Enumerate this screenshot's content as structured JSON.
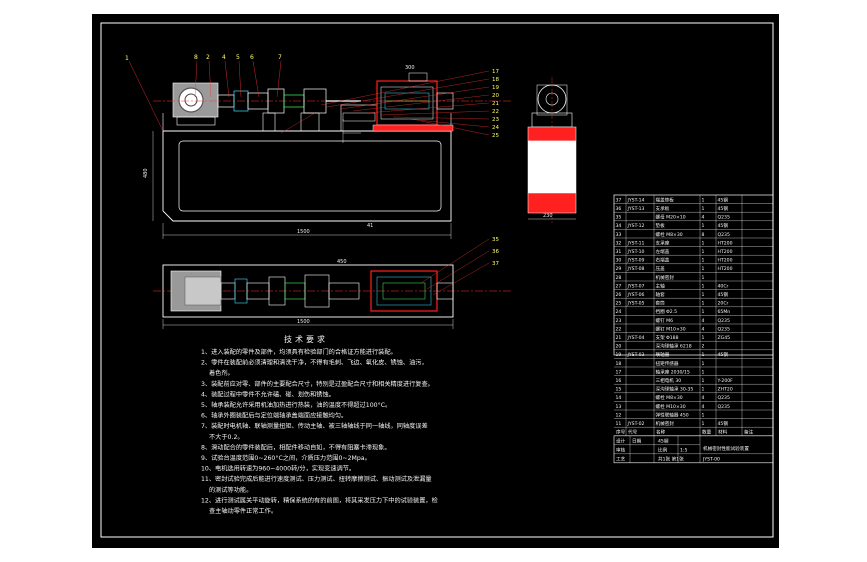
{
  "balloons": {
    "left": [
      "8",
      "2",
      "4",
      "5",
      "6",
      "7"
    ],
    "far_left": "1",
    "right": [
      "17",
      "18",
      "19",
      "20",
      "21",
      "22",
      "23",
      "24",
      "25"
    ],
    "plan": [
      "35",
      "36",
      "37"
    ]
  },
  "dims": {
    "front_len": "1500",
    "front_h": "480",
    "front_off": "41",
    "front_seg": "300",
    "plan_len": "1500",
    "plan_seg": "450",
    "side_w": "230"
  },
  "notes": {
    "title": "技术要求",
    "lines": [
      "1、进入装配的零件及部件，均须具有检验部门的合格证方能进行装配。",
      "2、零件在装配前必须清理和清洗干净，不得有毛刺、飞边、氧化皮、锈蚀、油污，",
      "着色剂。",
      "3、装配前应对零、部件的主要配合尺寸，特别是过盈配合尺寸和相关精度进行复查。",
      "4、装配过程中零件不允许磕、碰、划伤和锈蚀。",
      "5、轴承装配允许采用机油加热进行热装，油的温度不得超过100°C。",
      "6、轴承外圈装配后与定位端轴承盖端面应接触均匀。",
      "7、装配时电机轴、联轴测量扭矩、传动主轴、被三轴轴线于同一轴线，同轴度误差",
      "不大于0.2。",
      "8、滑动配合的零件装配后，相配件移动自如，不得有阻塞卡滞现象。",
      "9、试验台温度范围0~260°C之间，介质压力范围0~2Mpa。",
      "10、电机选用转速为960~4000转/分，实现变速调节。",
      "11、密封试验完成后能进行速度测试、压力测试、扭转摩擦测试、振动测试及泄漏量",
      "的测试等功能。",
      "12、进行测试属关平动旋转，精保系统的有的前图，将其采发压力下中的试验装置，检",
      "查主轴动零件正常工作。"
    ]
  },
  "bom": {
    "rows": [
      [
        "37",
        "JYST-14",
        "端盖垫板",
        "1",
        "45钢"
      ],
      [
        "36",
        "JYST-13",
        "支承板",
        "1",
        "45钢"
      ],
      [
        "35",
        "",
        "螺母 M20×10",
        "4",
        "Q235"
      ],
      [
        "34",
        "JYST-12",
        "垫板",
        "1",
        "45钢"
      ],
      [
        "33",
        "",
        "螺栓 M8×30",
        "8",
        "Q235"
      ],
      [
        "32",
        "JYST-11",
        "支承座",
        "1",
        "HT200"
      ],
      [
        "31",
        "JYST-10",
        "左端盖",
        "1",
        "HT200"
      ],
      [
        "30",
        "JYST-09",
        "右端盖",
        "1",
        "HT200"
      ],
      [
        "29",
        "JYST-08",
        "压盖",
        "1",
        "HT200"
      ],
      [
        "28",
        "",
        "机械密封",
        "1",
        ""
      ],
      [
        "27",
        "JYST-07",
        "主轴",
        "1",
        "40Cr"
      ],
      [
        "26",
        "JYST-06",
        "轴套",
        "1",
        "45钢"
      ],
      [
        "25",
        "JYST-05",
        "套筒",
        "1",
        "20Cr"
      ],
      [
        "24",
        "",
        "挡圈 Φ2.5",
        "1",
        "65Mn"
      ],
      [
        "23",
        "",
        "螺钉 M6",
        "4",
        "Q235"
      ],
      [
        "22",
        "",
        "螺钉 M10×30",
        "4",
        "Q235"
      ],
      [
        "21",
        "JYST-04",
        "支架 Φ188",
        "1",
        "ZG45"
      ],
      [
        "20",
        "",
        "深沟球轴承 6218",
        "2",
        ""
      ],
      [
        "19",
        "JYST-03",
        "联轴器",
        "1",
        "45钢"
      ],
      [
        "18",
        "",
        "扭矩传感器",
        "1",
        ""
      ],
      [
        "17",
        "",
        "轴承座 2030/15",
        "1",
        ""
      ],
      [
        "16",
        "",
        "三相电机 30",
        "1",
        "Y-200F"
      ],
      [
        "15",
        "",
        "深沟球轴承 30-35",
        "1",
        "ZHT20"
      ],
      [
        "14",
        "",
        "螺栓 M8×30",
        "4",
        "Q235"
      ],
      [
        "13",
        "",
        "螺栓 M10×30",
        "4",
        "Q235"
      ],
      [
        "12",
        "",
        "弹性联轴器 450",
        "1",
        ""
      ],
      [
        "11",
        "JYST-02",
        "机械密封",
        "1",
        "45钢"
      ]
    ],
    "header": [
      "序号",
      "代号",
      "名称",
      "数量",
      "材料",
      "备注"
    ],
    "title_block": {
      "design": "设计",
      "check": "审核",
      "process": "工艺",
      "date": "日期",
      "scale_label": "比例",
      "scale": "1:5",
      "qty_label": "45钢",
      "sheet": "共1张 第1张",
      "drawing_title": "机械密封性能试验装置",
      "drawing_no": "JYST-00"
    }
  },
  "colors": {
    "background": "#000000",
    "line": "#ffffff",
    "accent": "#ff2020",
    "label": "#ffff66",
    "leader": "#ff3333",
    "motor": "#bbbbbb",
    "cyan": "#40e0ff",
    "green": "#40ff60"
  }
}
